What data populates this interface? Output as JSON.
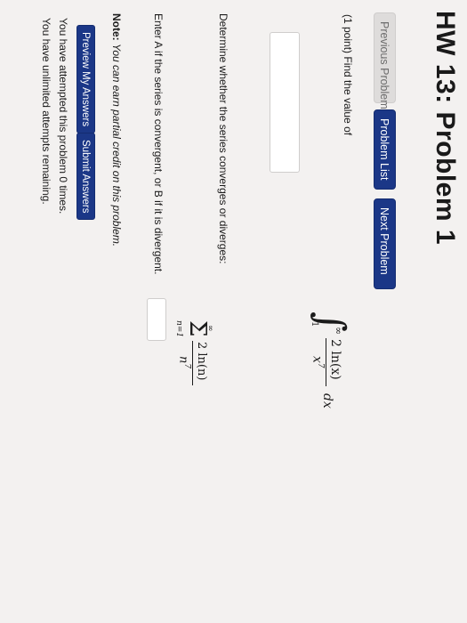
{
  "page": {
    "title": "HW 13: Problem 1"
  },
  "nav": {
    "previous_label": "Previous Problem",
    "list_label": "Problem List",
    "next_label": "Next Problem"
  },
  "problem": {
    "prompt_points": "(1 point)",
    "prompt_text": "Find the value of",
    "integral": {
      "lower": "1",
      "upper": "∞",
      "numerator": "2 ln(x)",
      "denominator": "x",
      "denominator_exp": "7",
      "differential": "dx"
    },
    "part2_text": "Determine whether the series converges or diverges:",
    "series": {
      "upper": "∞",
      "lower": "n=1",
      "numerator": "2 ln(n)",
      "denominator": "n",
      "denominator_exp": "7"
    },
    "part2_instruction": "Enter A if the series is convergent, or B if it is divergent."
  },
  "note": {
    "label": "Note:",
    "text": "You can earn partial credit on this problem."
  },
  "actions": {
    "preview_label": "Preview My Answers",
    "submit_label": "Submit Answers"
  },
  "status": {
    "attempts": "You have attempted this problem 0 times.",
    "remaining": "You have unlimited attempts remaining."
  },
  "colors": {
    "primary_button": "#1b3787",
    "disabled_button": "#dedcdb",
    "page_background": "#f3f1f0"
  }
}
